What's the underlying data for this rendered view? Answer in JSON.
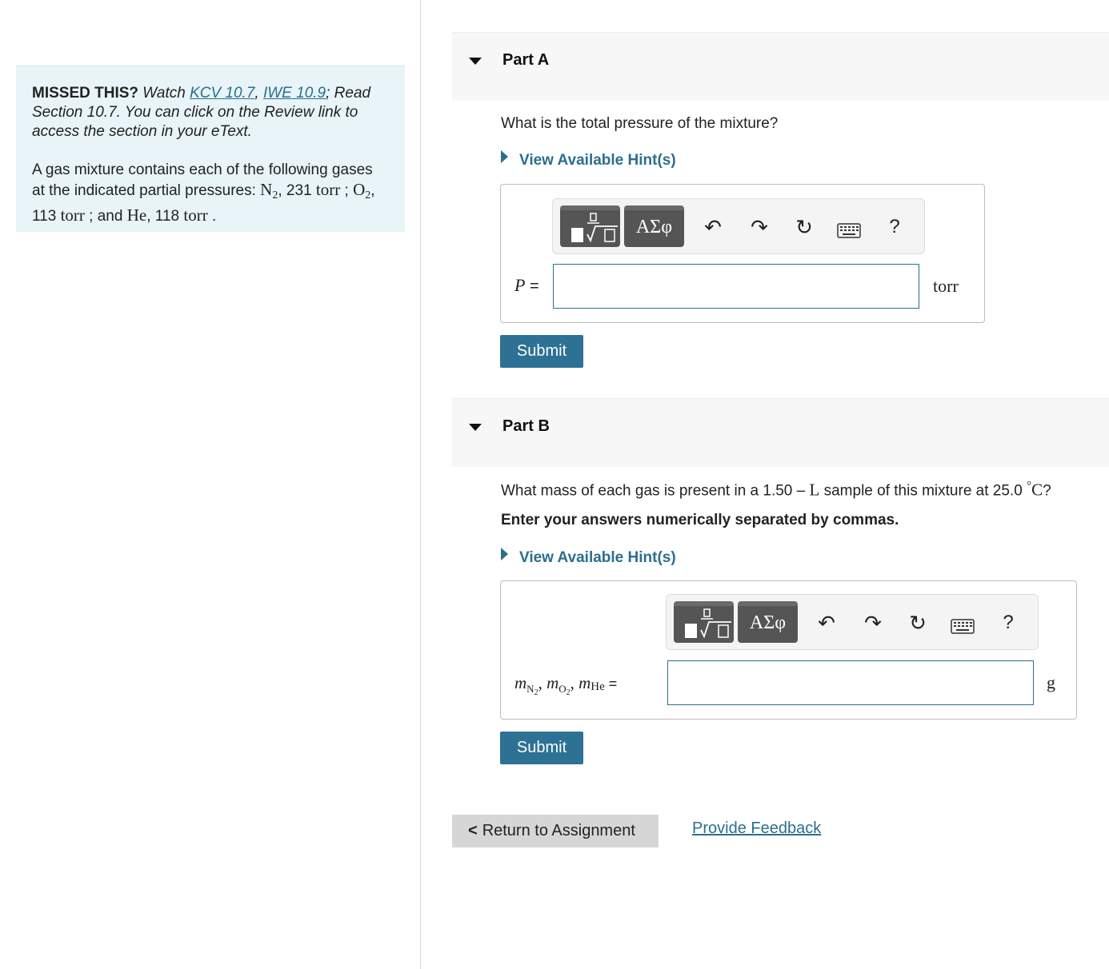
{
  "info": {
    "missed_label": "MISSED THIS?",
    "watch_text": " Watch ",
    "link_kcv": "KCV 10.7",
    "comma": ", ",
    "link_iwe": "IWE 10.9",
    "rest_text": "; Read Section 10.7. You can click on the Review link to access the section in your eText.",
    "problem_intro": "A gas mixture contains each of the following gases at the indicated partial pressures: ",
    "gas1": "N",
    "gas1_sub": "2",
    "gas1_val": ", 231 ",
    "unit_torr": "torr",
    "sep1": " ; ",
    "gas2": "O",
    "gas2_sub": "2",
    "gas2_val": ", 113 ",
    "sep2": " ; and ",
    "gas3": "He",
    "gas3_val": ", 118 ",
    "end": " ."
  },
  "part_a": {
    "title": "Part A",
    "question": "What is the total pressure of the mixture?",
    "hint_label": "View Available Hint(s)",
    "var_label": "P",
    "equals": " =",
    "unit": "torr",
    "input_value": "",
    "submit_label": "Submit"
  },
  "part_b": {
    "title": "Part B",
    "question_pre": "What mass of each gas is present in a 1.50 ",
    "question_dash": "–",
    "question_L": "L",
    "question_mid": " sample of this mixture at 25.0 ",
    "question_deg": "°",
    "question_C": "C",
    "question_end": "?",
    "instruction": "Enter your answers numerically separated by commas.",
    "hint_label": "View Available Hint(s)",
    "m": "m",
    "sub_n2": "N",
    "sub_n2_num": "2",
    "sub_o2": "O",
    "sub_o2_num": "2",
    "sub_he": "He",
    "comma": ", ",
    "equals": " =",
    "unit": "g",
    "input_value": "",
    "submit_label": "Submit"
  },
  "toolbar": {
    "greek_label": "ΑΣφ",
    "undo_icon": "↶",
    "redo_icon": "↷",
    "reset_icon": "↻",
    "help_label": "?"
  },
  "footer": {
    "return_label": "Return to Assignment",
    "chevron": "<",
    "feedback_label": "Provide Feedback"
  }
}
